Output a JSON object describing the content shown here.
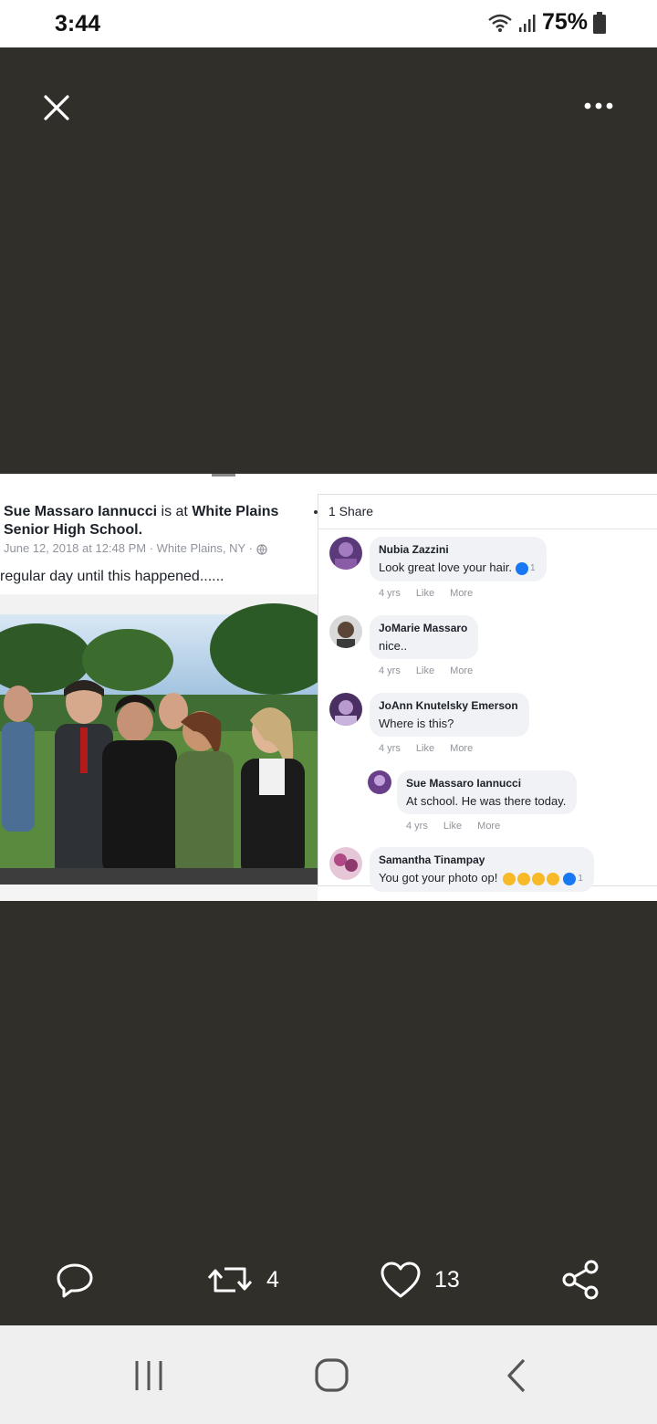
{
  "status_bar": {
    "time": "3:44",
    "battery": "75%",
    "icons": [
      "wifi-icon",
      "signal-icon",
      "battery-icon"
    ]
  },
  "viewer": {
    "close_icon": "close-icon",
    "more_icon": "more-options-icon",
    "background_color": "#302f29"
  },
  "facebook_post": {
    "author": "Sue Massaro Iannucci",
    "is_at": "is at",
    "place": "White Plains Senior High School",
    "meta": "June 12, 2018 at 12:48 PM · White Plains, NY ·",
    "caption": "regular day until this happened......",
    "shares": "1 Share",
    "comments": [
      {
        "name": "Nubia Zazzini",
        "text": "Look great love your hair.",
        "reactions": "1",
        "time": "4 yrs",
        "like": "Like",
        "more": "More"
      },
      {
        "name": "JoMarie Massaro",
        "text": "nice..",
        "time": "4 yrs",
        "like": "Like",
        "more": "More"
      },
      {
        "name": "JoAnn Knutelsky Emerson",
        "text": "Where is this?",
        "time": "4 yrs",
        "like": "Like",
        "more": "More"
      },
      {
        "name": "Sue Massaro Iannucci",
        "text": "At school. He was there today.",
        "time": "4 yrs",
        "like": "Like",
        "more": "More"
      },
      {
        "name": "Samantha Tinampay",
        "text": "You got your photo op!",
        "reactions": "1"
      }
    ]
  },
  "action_bar": {
    "reply_icon": "reply-icon",
    "retweet_icon": "retweet-icon",
    "retweet_count": "4",
    "like_icon": "heart-icon",
    "like_count": "13",
    "share_icon": "share-icon"
  },
  "nav_bar": {
    "icons": [
      "recent-apps-icon",
      "home-icon",
      "back-icon"
    ]
  }
}
